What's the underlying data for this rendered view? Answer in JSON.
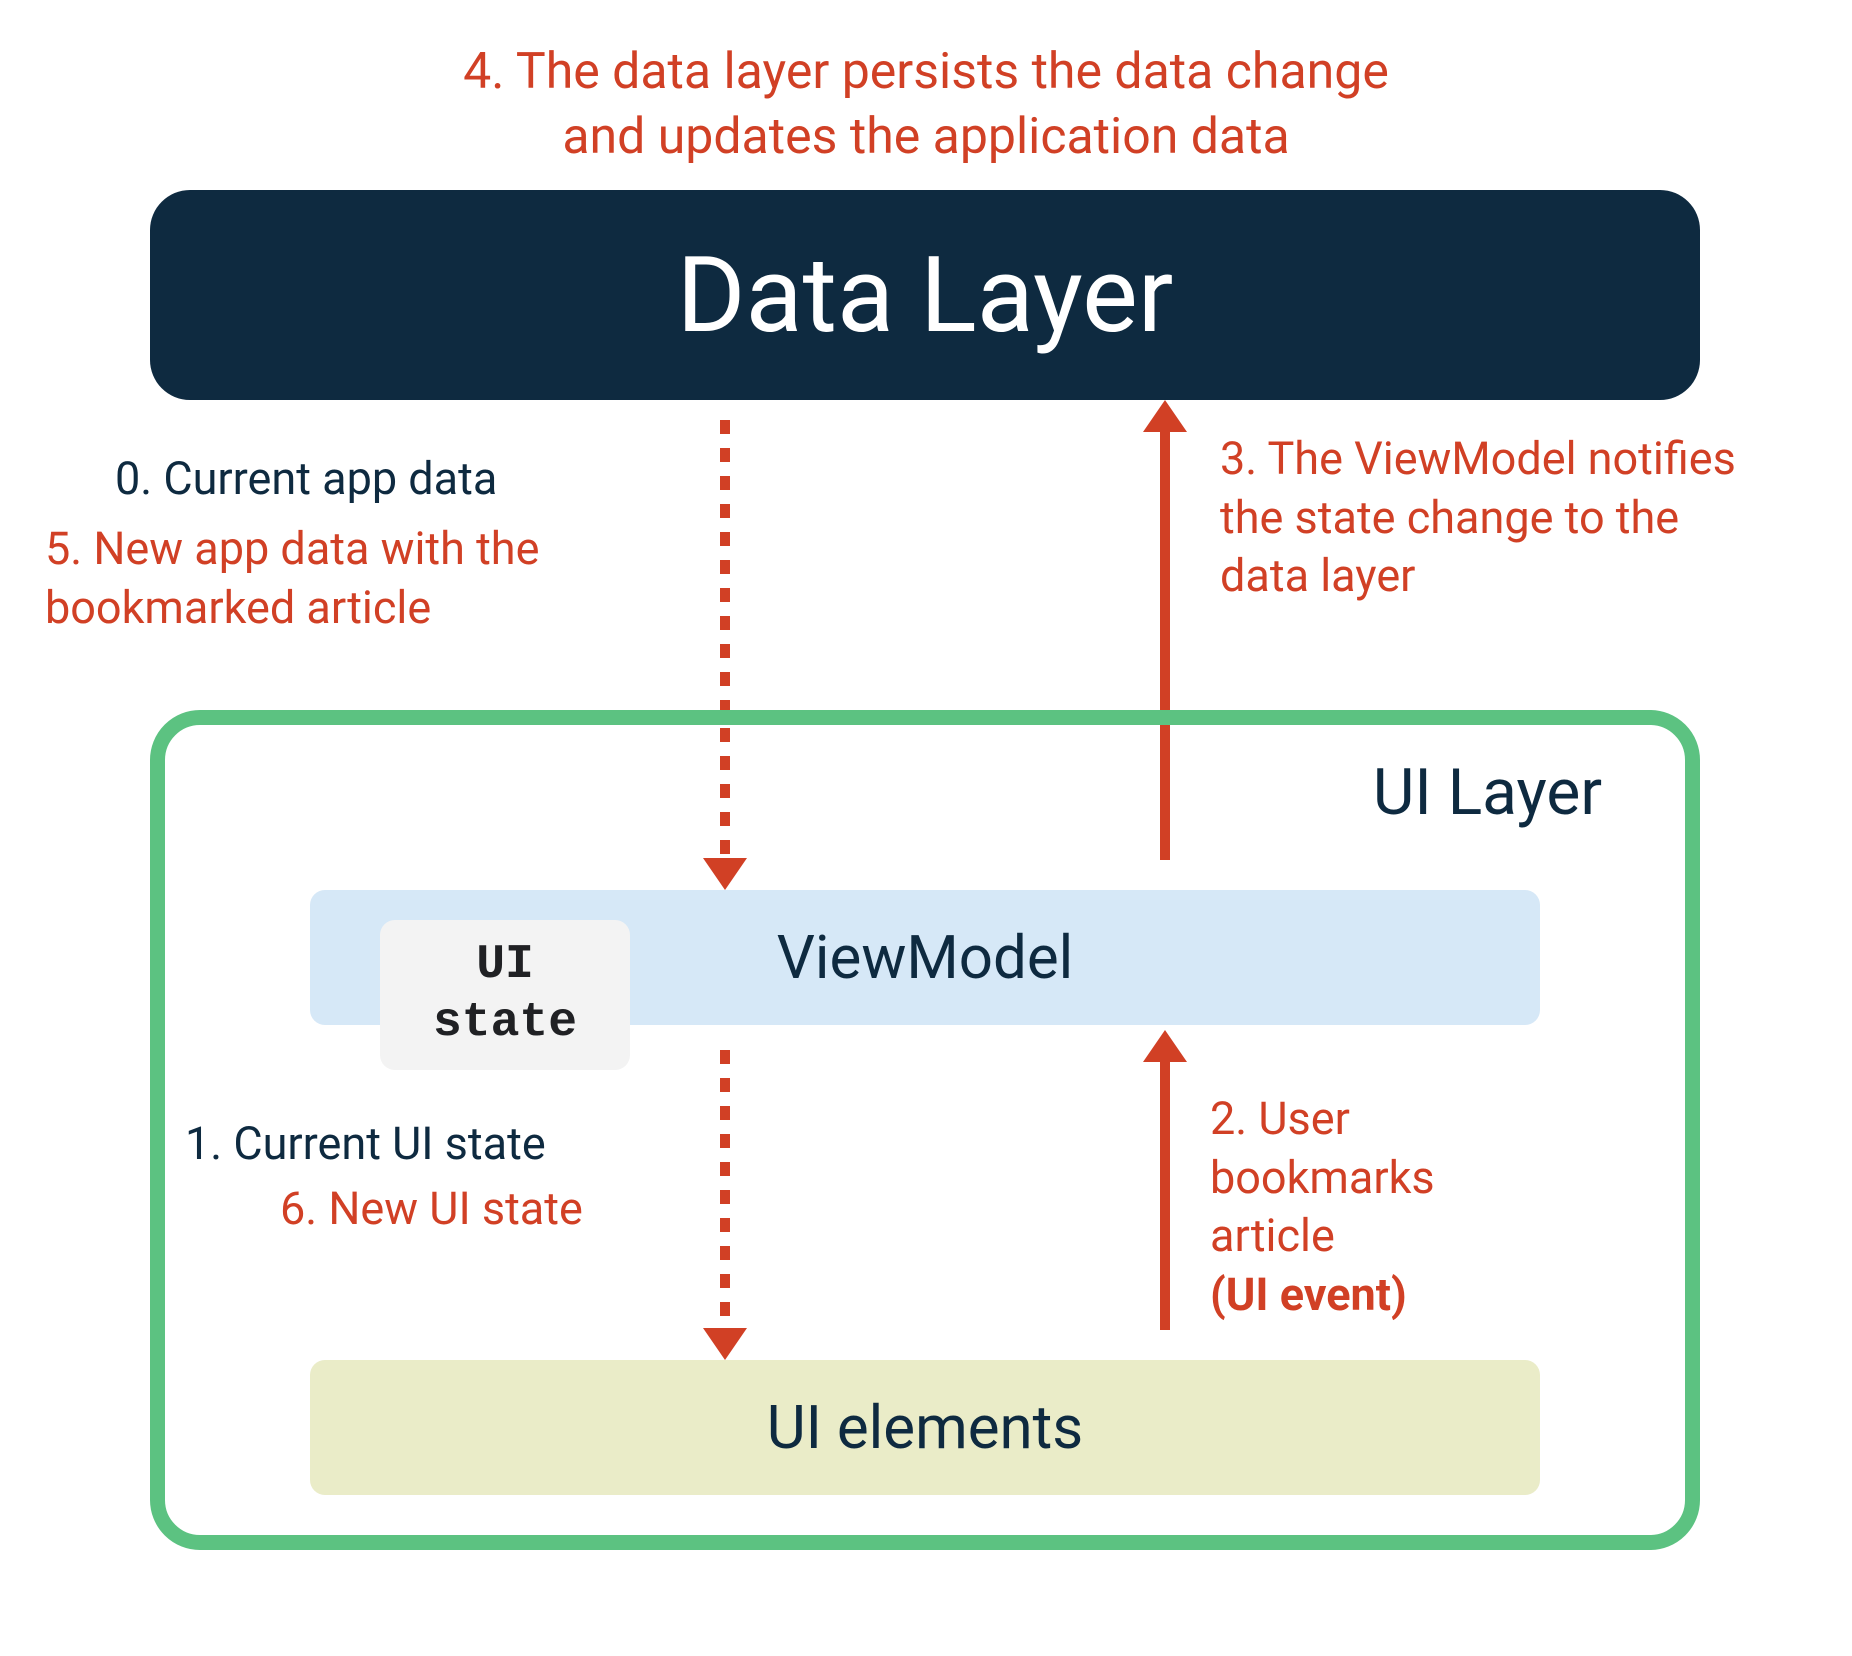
{
  "caption_top_line1": "4. The data layer persists the data change",
  "caption_top_line2": "and updates the application data",
  "data_layer": {
    "title": "Data Layer"
  },
  "ui_layer": {
    "title": "UI Layer"
  },
  "viewmodel": {
    "title": "ViewModel"
  },
  "ui_state_badge": "UI\nstate",
  "ui_elements": {
    "title": "UI elements"
  },
  "notes": {
    "n0": "0. Current app data",
    "n5": "5. New app data with the bookmarked article",
    "n3": "3. The ViewModel notifies the state change to the data layer",
    "n1": "1. Current UI state",
    "n6": "6. New UI state",
    "n2_pre": "2. User bookmarks article ",
    "n2_bold": "(UI event)"
  }
}
